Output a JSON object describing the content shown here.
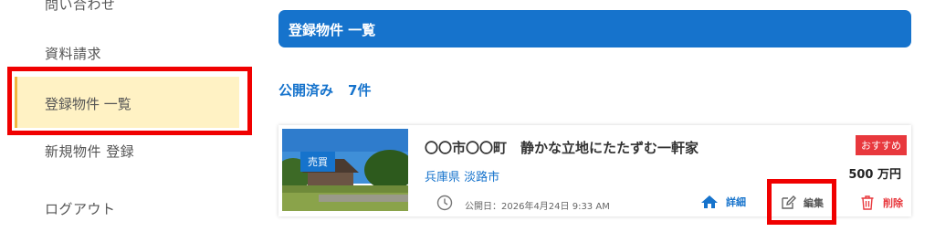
{
  "sidebar": {
    "items": [
      {
        "label": "問い合わせ"
      },
      {
        "label": "資料請求"
      },
      {
        "label": "登録物件 一覧"
      },
      {
        "label": "新規物件 登録"
      },
      {
        "label": "ログアウト"
      }
    ]
  },
  "header": {
    "title": "登録物件 一覧"
  },
  "status": {
    "label": "公開済み",
    "count": "7件"
  },
  "property": {
    "badge": "売買",
    "title": "〇〇市〇〇町　静かな立地にたたずむ一軒家",
    "location": "兵庫県 淡路市",
    "published": "公開日：2026年4月24日 9:33 AM",
    "recommend": "おすすめ",
    "price": "500 万円",
    "detail_label": "詳細",
    "edit_label": "編集",
    "delete_label": "削除"
  },
  "colors": {
    "primary": "#1673cc",
    "active_bg": "#fff2c4",
    "danger": "#e8383d",
    "highlight": "#f00000"
  }
}
